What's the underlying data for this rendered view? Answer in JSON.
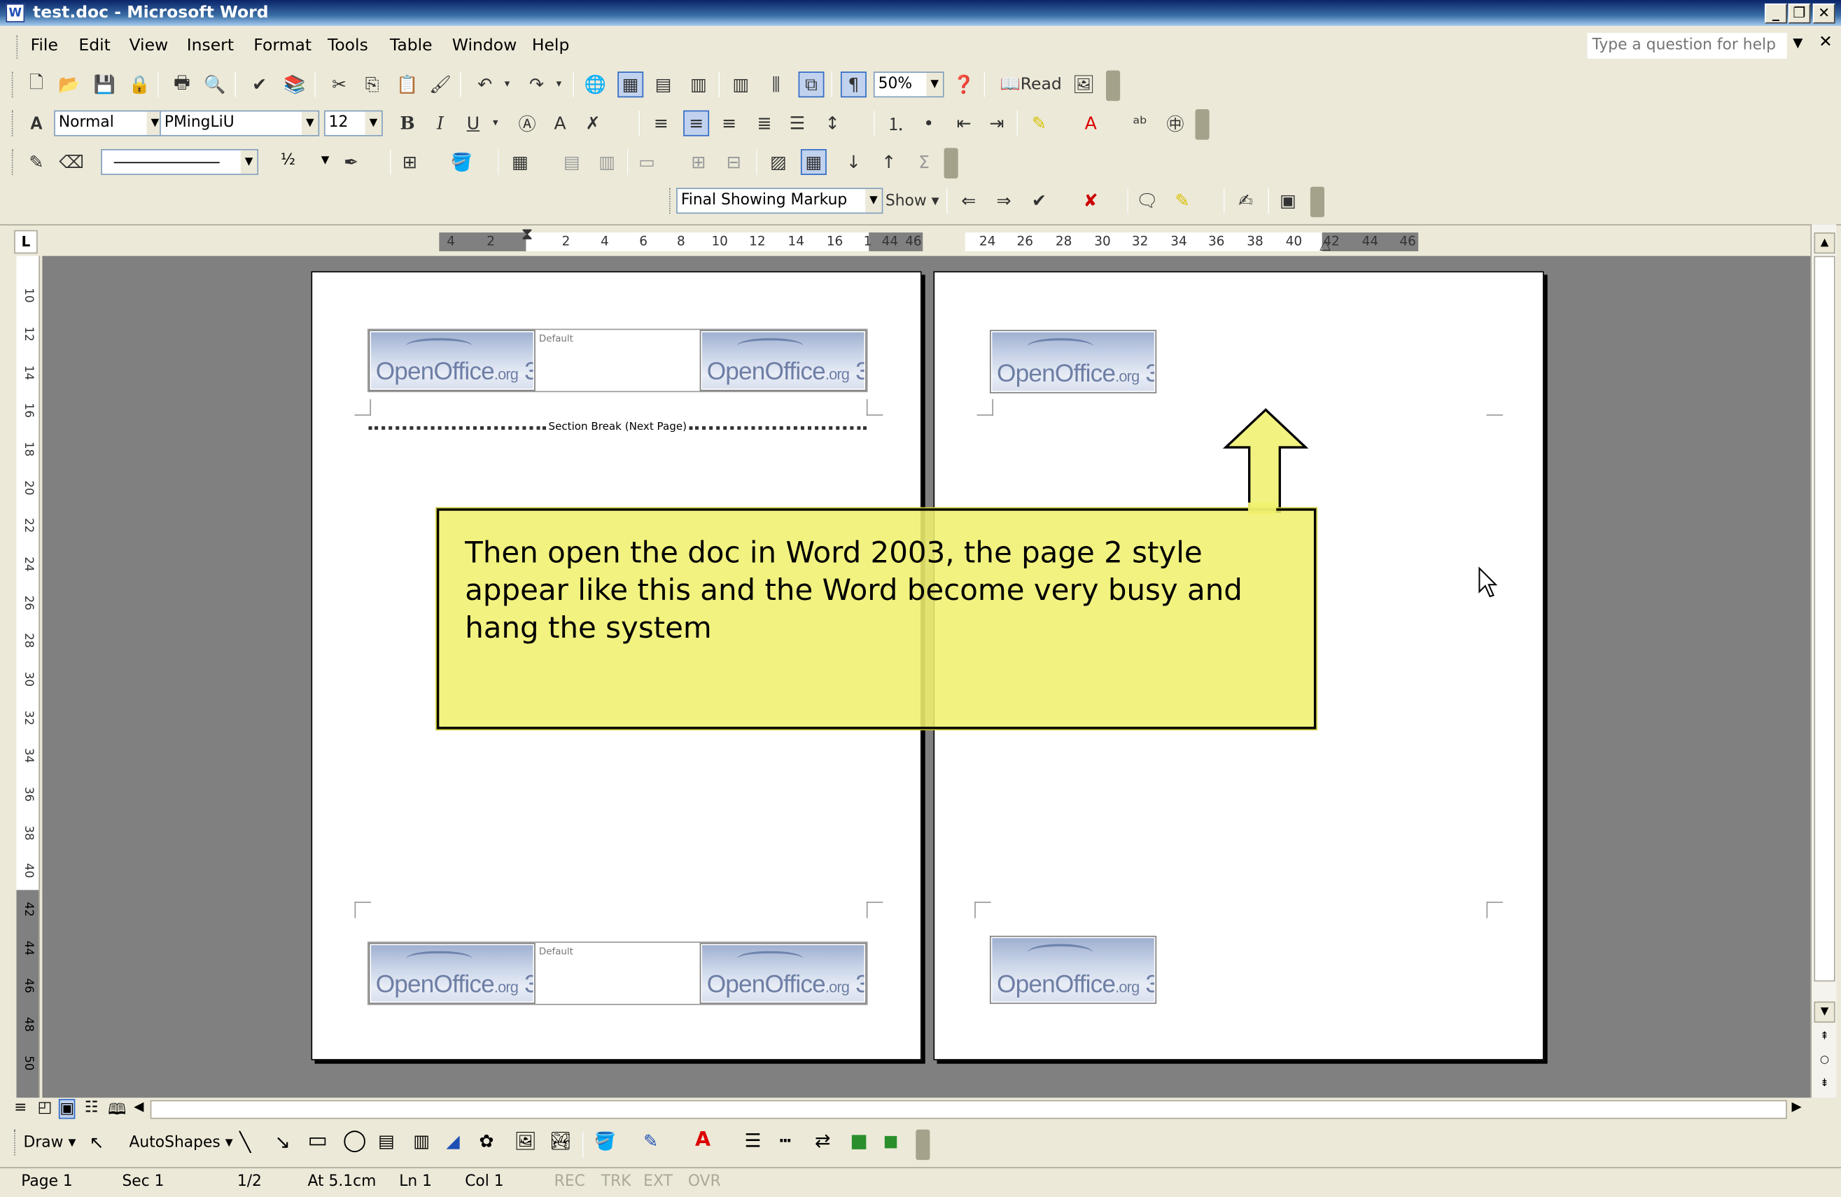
{
  "window": {
    "title": "test.doc - Microsoft Word",
    "app_icon": "W"
  },
  "menu": [
    "File",
    "Edit",
    "View",
    "Insert",
    "Format",
    "Tools",
    "Table",
    "Window",
    "Help"
  ],
  "help_box": {
    "placeholder": "Type a question for help"
  },
  "toolbar_standard": {
    "zoom": "50%",
    "read_label": "Read"
  },
  "toolbar_formatting": {
    "style": "Normal",
    "font": "PMingLiU",
    "size": "12",
    "bold": "B",
    "italic": "I",
    "underline": "U"
  },
  "toolbar_tables": {
    "line_weight": "½"
  },
  "toolbar_reviewing": {
    "display": "Final Showing Markup",
    "show_label": "Show"
  },
  "ruler": {
    "corner": "L",
    "ticks_left": [
      "4",
      "2",
      "2",
      "4",
      "6",
      "8",
      "10",
      "12",
      "14",
      "16",
      "1",
      "44",
      "46"
    ],
    "ticks_right": [
      "24",
      "26",
      "28",
      "30",
      "32",
      "34",
      "36",
      "38",
      "40",
      "42",
      "44",
      "46"
    ],
    "vertical": [
      "10",
      "12",
      "14",
      "16",
      "18",
      "20",
      "22",
      "24",
      "26",
      "28",
      "30",
      "32",
      "34",
      "36",
      "38",
      "40",
      "42",
      "44",
      "46",
      "48",
      "50"
    ]
  },
  "document": {
    "logo_text": "OpenOffice",
    "logo_org": ".org",
    "logo_version": "3",
    "header_label": "Default",
    "section_break": "Section Break (Next Page)"
  },
  "callout": {
    "text": "Then open the doc in Word 2003, the page 2 style appear like this and the Word become very busy and hang the system",
    "fill_color": "#f0f06e"
  },
  "drawing_toolbar": {
    "draw_label": "Draw",
    "autoshapes_label": "AutoShapes"
  },
  "status": {
    "page": "Page 1",
    "section": "Sec 1",
    "page_of": "1/2",
    "at": "At 5.1cm",
    "line": "Ln 1",
    "col": "Col 1",
    "rec": "REC",
    "trk": "TRK",
    "ext": "EXT",
    "ovr": "OVR"
  }
}
